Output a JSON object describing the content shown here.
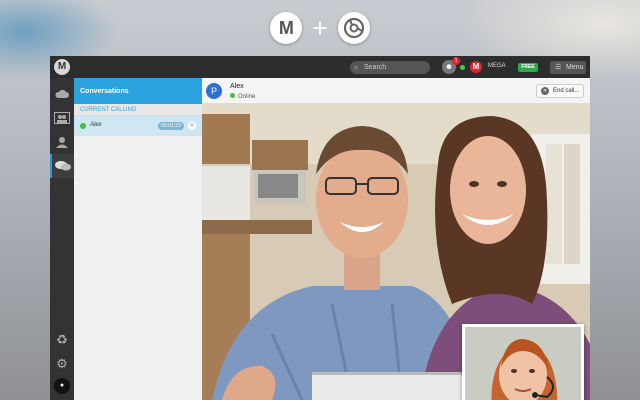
{
  "logos": {
    "left_icon": "mega-logo",
    "right_icon": "chrome-logo",
    "left_glyph": "M",
    "plus": "+"
  },
  "topbar": {
    "logo_glyph": "M",
    "search": {
      "placeholder": "Search",
      "icon": "search-icon"
    },
    "notification_count": "1",
    "account_logo_glyph": "M",
    "account_name": "MEGA",
    "plan_badge": "FREE",
    "menu_label": "Menu",
    "menu_icon": "hamburger-icon"
  },
  "rail": {
    "items": [
      "cloud-icon",
      "contacts-icon",
      "user-icon",
      "chat-icon"
    ],
    "bottom_items": [
      "recycle-icon",
      "settings-icon"
    ]
  },
  "conversations": {
    "header": "Conversations",
    "section_label": "CURRENT CALLING",
    "rows": [
      {
        "name": "Alex",
        "timer": "00:01:23",
        "status": "online"
      }
    ]
  },
  "call": {
    "avatar_letter": "P",
    "contact_name": "Alex",
    "status": "Online",
    "end_call_label": "End call..."
  },
  "colors": {
    "accent": "#2ba3df",
    "online": "#3fbf3f",
    "brand_red": "#d9272e",
    "free_badge": "#2fa84f"
  }
}
